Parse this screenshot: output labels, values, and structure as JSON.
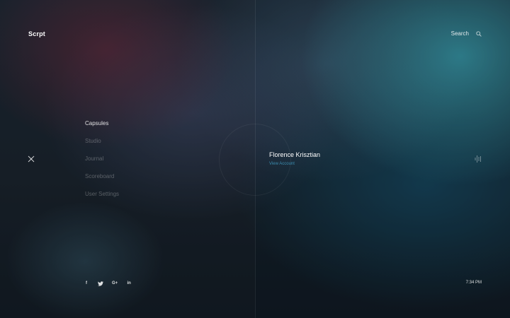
{
  "app": {
    "logo": "Scrpt"
  },
  "header": {
    "search_label": "Search",
    "search_icon": "search-icon"
  },
  "menu": {
    "close_icon": "close-icon",
    "items": [
      {
        "label": "Capsules",
        "active": true
      },
      {
        "label": "Studio",
        "active": false
      },
      {
        "label": "Journal",
        "active": false
      },
      {
        "label": "Scoreboard",
        "active": false
      },
      {
        "label": "User Settings",
        "active": false
      }
    ]
  },
  "profile": {
    "name": "Florence Krisztian",
    "link": "View Account"
  },
  "audio": {
    "icon": "audio-bars-icon"
  },
  "social": [
    {
      "label": "f",
      "icon": "facebook-icon"
    },
    {
      "label": "",
      "icon": "twitter-icon"
    },
    {
      "label": "G+",
      "icon": "google-plus-icon"
    },
    {
      "label": "in",
      "icon": "linkedin-icon"
    }
  ],
  "footer": {
    "time": "7:34 PM"
  },
  "colors": {
    "accent": "#3b8db0",
    "text_primary": "#ffffff",
    "text_muted": "rgba(255,255,255,0.28)"
  }
}
